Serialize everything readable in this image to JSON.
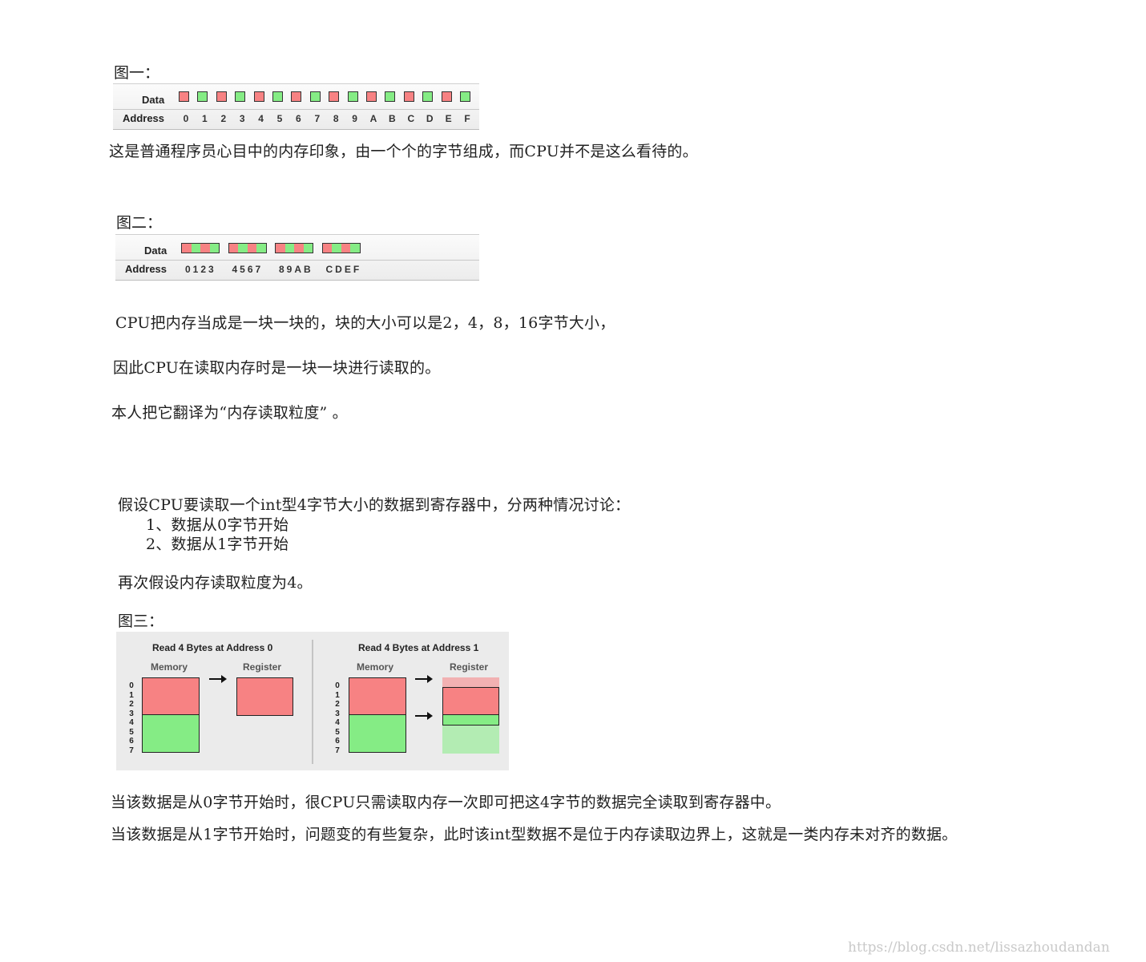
{
  "fig1": {
    "caption": "图一：",
    "data_label": "Data",
    "address_label": "Address",
    "cells": [
      "red",
      "green",
      "red",
      "green",
      "red",
      "green",
      "red",
      "green",
      "red",
      "green",
      "red",
      "green",
      "red",
      "green",
      "red",
      "green"
    ],
    "addresses": [
      "0",
      "1",
      "2",
      "3",
      "4",
      "5",
      "6",
      "7",
      "8",
      "9",
      "A",
      "B",
      "C",
      "D",
      "E",
      "F"
    ]
  },
  "para1": "这是普通程序员心目中的内存印象，由一个个的字节组成，而CPU并不是这么看待的。",
  "fig2": {
    "caption": "图二：",
    "data_label": "Data",
    "address_label": "Address",
    "block_addresses": [
      "0123",
      "4567",
      "89AB",
      "CDEF"
    ]
  },
  "para2": "CPU把内存当成是一块一块的，块的大小可以是2，4，8，16字节大小，",
  "para3": "因此CPU在读取内存时是一块一块进行读取的。",
  "para4": "本人把它翻译为“内存读取粒度” 。",
  "para5": "假设CPU要读取一个int型4字节大小的数据到寄存器中，分两种情况讨论：",
  "list": [
    "1、数据从0字节开始",
    "2、数据从1字节开始"
  ],
  "para6": "再次假设内存读取粒度为4。",
  "fig3": {
    "caption": "图三：",
    "left_title": "Read 4 Bytes at Address 0",
    "right_title": "Read 4 Bytes at Address 1",
    "memory_label": "Memory",
    "register_label": "Register",
    "addresses": [
      "0",
      "1",
      "2",
      "3",
      "4",
      "5",
      "6",
      "7"
    ]
  },
  "para7": "当该数据是从0字节开始时，很CPU只需读取内存一次即可把这4字节的数据完全读取到寄存器中。",
  "para8": "当该数据是从1字节开始时，问题变的有些复杂，此时该int型数据不是位于内存读取边界上，这就是一类内存未对齐的数据。",
  "watermark": "https://blog.csdn.net/lissazhoudandan",
  "colors": {
    "red": "#f78283",
    "green": "#85ec85"
  }
}
